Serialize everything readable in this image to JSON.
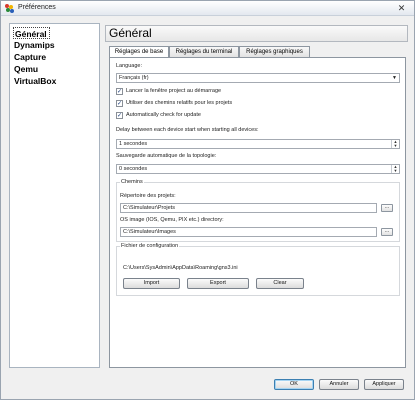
{
  "window": {
    "title": "Préférences",
    "close_glyph": "✕"
  },
  "sidebar": {
    "items": [
      "Général",
      "Dynamips",
      "Capture",
      "Qemu",
      "VirtualBox"
    ],
    "selected": 0
  },
  "page": {
    "title": "Général"
  },
  "tabs": [
    "Réglages de base",
    "Réglages du terminal",
    "Réglages graphiques"
  ],
  "general": {
    "language_label": "Language:",
    "language_value": "Français (fr)",
    "checkboxes": [
      {
        "label": "Lancer la fenêtre project au démarrage",
        "checked": true
      },
      {
        "label": "Utiliser des chemins relatifs pour les projets",
        "checked": true
      },
      {
        "label": "Automatically check for update",
        "checked": true
      }
    ],
    "delay_label": "Delay between each device start when starting all devices:",
    "delay_value": "1 secondes",
    "autosave_label": "Sauvegarde automatique de la topologie:",
    "autosave_value": "0 secondes",
    "paths": {
      "title": "Chemins",
      "projects_label": "Répertoire des projets:",
      "projects_value": "C:\\Simulateur\\Projets",
      "images_label": "OS image (IOS, Qemu, PIX etc.) directory:",
      "images_value": "C:\\Simulateur\\Images",
      "browse_label": "..."
    },
    "config": {
      "title": "Fichier de configuration",
      "path": "C:\\Users\\SysAdmin\\AppData\\Roaming\\gns3.ini",
      "import_label": "Import",
      "export_label": "Export",
      "clear_label": "Clear"
    }
  },
  "footer": {
    "ok_label": "OK",
    "cancel_label": "Annuler",
    "apply_label": "Appliquer"
  },
  "colors": {
    "accent": "#3c7fb1",
    "check": "#1a3c7a"
  }
}
